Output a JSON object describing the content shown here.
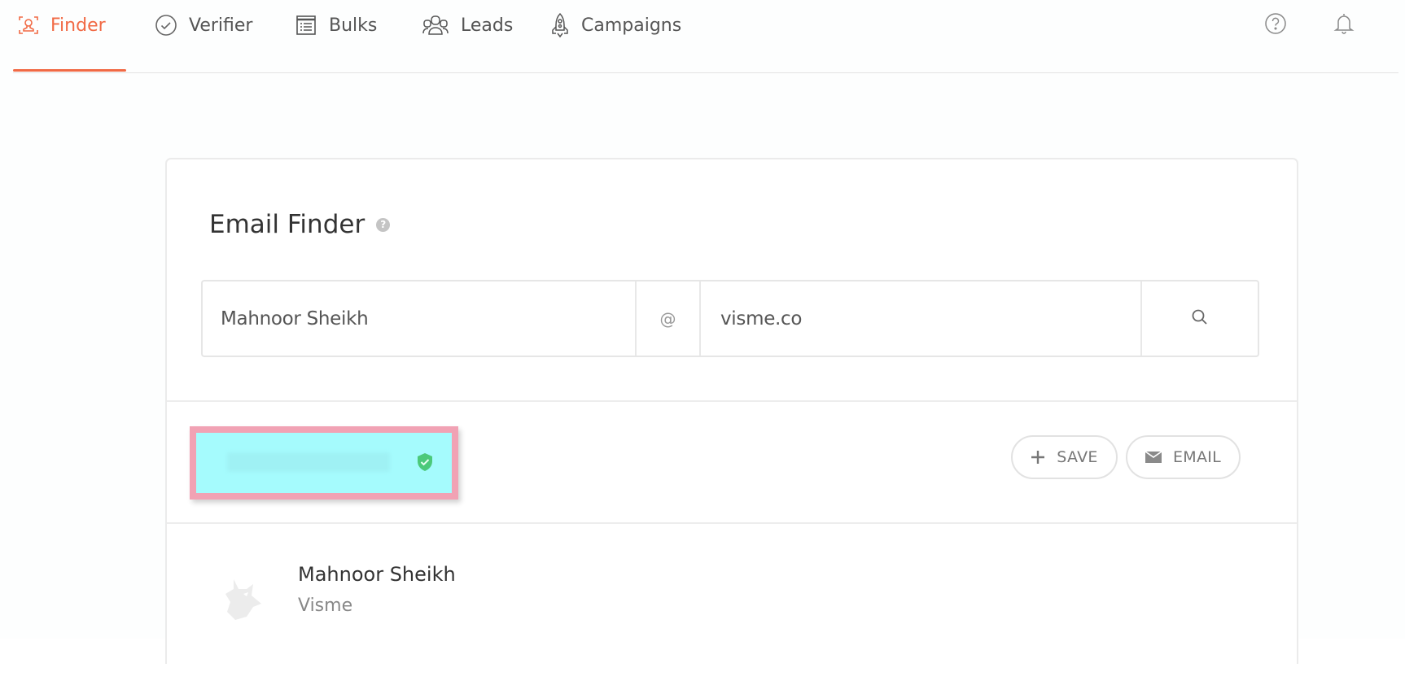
{
  "nav": {
    "items": [
      {
        "id": "finder",
        "label": "Finder",
        "icon": "finder-icon",
        "active": true
      },
      {
        "id": "verifier",
        "label": "Verifier",
        "icon": "check-circle-icon",
        "active": false
      },
      {
        "id": "bulks",
        "label": "Bulks",
        "icon": "list-icon",
        "active": false
      },
      {
        "id": "leads",
        "label": "Leads",
        "icon": "users-icon",
        "active": false
      },
      {
        "id": "campaigns",
        "label": "Campaigns",
        "icon": "rocket-icon",
        "active": false
      }
    ],
    "right_icons": [
      "help-circle-icon",
      "bell-icon"
    ]
  },
  "colors": {
    "accent": "#f16a45",
    "verified": "#4cc97a",
    "highlight_border": "#f1a2b4",
    "highlight_fill": "#a5fbfd"
  },
  "finder": {
    "title": "Email Finder",
    "title_help": "?",
    "full_name_value": "Mahnoor Sheikh",
    "at_symbol": "@",
    "domain_value": "visme.co",
    "search_icon": "search-icon"
  },
  "result": {
    "email_redacted": "",
    "verified_icon": "shield-check-icon",
    "save_label": "SAVE",
    "email_label": "EMAIL"
  },
  "person": {
    "name": "Mahnoor Sheikh",
    "company": "Visme",
    "avatar_icon": "fox-avatar-icon"
  }
}
